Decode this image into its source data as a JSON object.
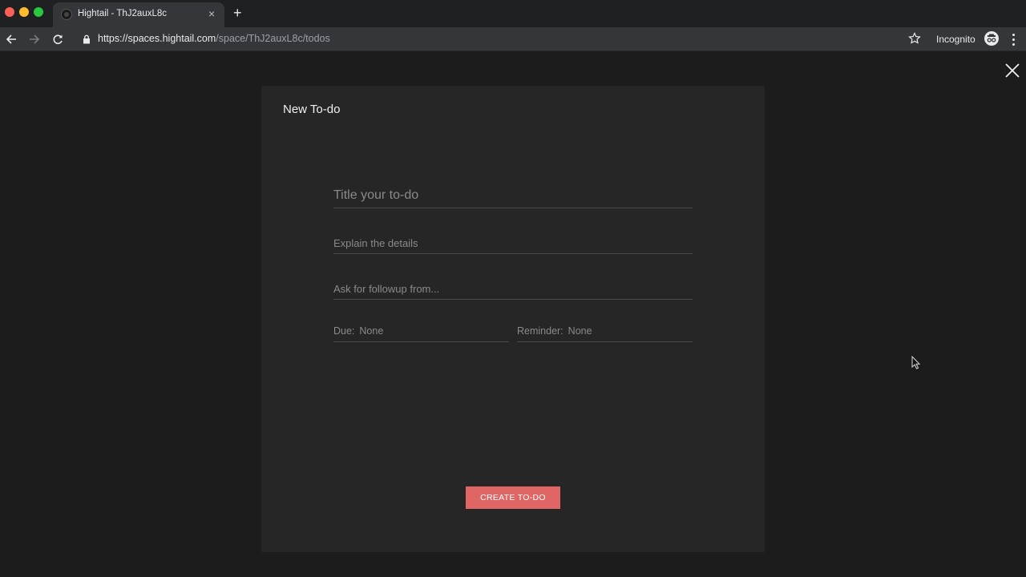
{
  "browser": {
    "tab_title": "Hightail - ThJ2auxL8c",
    "tab_close": "×",
    "new_tab": "+",
    "url_host": "https://spaces.hightail.com",
    "url_path": "/space/ThJ2auxL8c/todos",
    "incognito_label": "Incognito",
    "icons": [
      "back-arrow-icon",
      "forward-arrow-icon",
      "reload-icon",
      "lock-icon",
      "star-icon",
      "incognito-icon",
      "menu-dots-icon"
    ]
  },
  "modal": {
    "title": "New To-do",
    "title_placeholder": "Title your to-do",
    "details_placeholder": "Explain the details",
    "followup_placeholder": "Ask for followup from...",
    "due_label": "Due:",
    "due_value": "None",
    "reminder_label": "Reminder:",
    "reminder_value": "None",
    "create_button": "CREATE TO-DO"
  },
  "colors": {
    "background": "#1c1c1c",
    "modal": "#262626",
    "accent": "#e06666"
  }
}
